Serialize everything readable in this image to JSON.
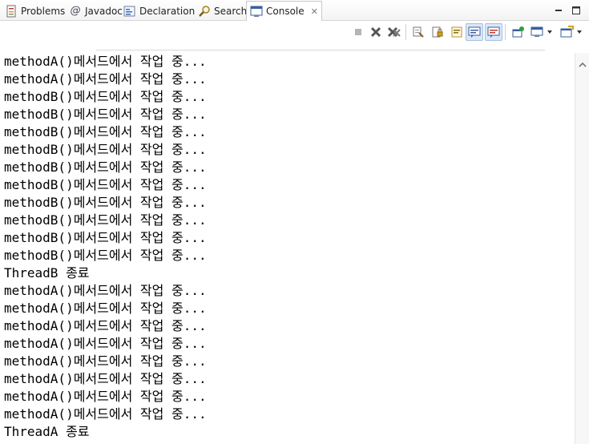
{
  "tabs": [
    {
      "label": "Problems",
      "icon": "problems-icon"
    },
    {
      "label": "Javadoc",
      "icon": "javadoc-icon"
    },
    {
      "label": "Declaration",
      "icon": "declaration-icon"
    },
    {
      "label": "Search",
      "icon": "search-icon"
    },
    {
      "label": "Console",
      "icon": "console-icon",
      "active": true
    }
  ],
  "tab_close_glyph": "✕",
  "toolbar": {
    "buttons": [
      "terminate-icon",
      "remove-launch-icon",
      "remove-all-terminated-icon",
      "clear-console-icon",
      "scroll-lock-icon",
      "word-wrap-icon",
      "show-on-stdout-icon",
      "show-on-stderr-icon",
      "pin-console-icon",
      "display-selected-console-icon",
      "open-console-icon"
    ]
  },
  "colors": {
    "console_bg": "#ffffff",
    "text": "#000000",
    "tab_active_border": "#c9c9c9",
    "pressed": "#dbe7f7"
  },
  "console": {
    "lines": [
      "methodA()메서드에서 작업 중...",
      "methodA()메서드에서 작업 중...",
      "methodB()메서드에서 작업 중...",
      "methodB()메서드에서 작업 중...",
      "methodB()메서드에서 작업 중...",
      "methodB()메서드에서 작업 중...",
      "methodB()메서드에서 작업 중...",
      "methodB()메서드에서 작업 중...",
      "methodB()메서드에서 작업 중...",
      "methodB()메서드에서 작업 중...",
      "methodB()메서드에서 작업 중...",
      "methodB()메서드에서 작업 중...",
      "ThreadB 종료",
      "methodA()메서드에서 작업 중...",
      "methodA()메서드에서 작업 중...",
      "methodA()메서드에서 작업 중...",
      "methodA()메서드에서 작업 중...",
      "methodA()메서드에서 작업 중...",
      "methodA()메서드에서 작업 중...",
      "methodA()메서드에서 작업 중...",
      "methodA()메서드에서 작업 중...",
      "ThreadA 종료"
    ]
  }
}
